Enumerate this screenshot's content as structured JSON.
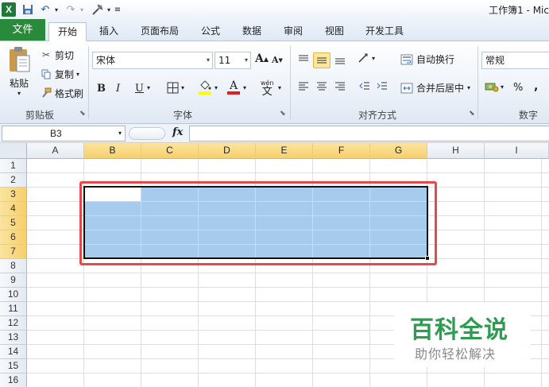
{
  "titlebar": {
    "title": "工作簿1  -  Mic",
    "undo_icon": "undo-icon",
    "redo_icon": "redo-icon",
    "save_icon": "save-icon"
  },
  "tabs": {
    "file": "文件",
    "items": [
      "开始",
      "插入",
      "页面布局",
      "公式",
      "数据",
      "审阅",
      "视图",
      "开发工具"
    ]
  },
  "ribbon": {
    "clipboard": {
      "paste": "粘贴",
      "cut": "剪切",
      "copy": "复制",
      "format_painter": "格式刷",
      "group_label": "剪贴板"
    },
    "font": {
      "font_name": "宋体",
      "font_size": "11",
      "bold": "B",
      "italic": "I",
      "underline": "U",
      "phonetic": "wén",
      "phonetic_char": "文",
      "group_label": "字体"
    },
    "alignment": {
      "wrap_text": "自动换行",
      "merge_center": "合并后居中",
      "group_label": "对齐方式"
    },
    "number": {
      "format": "常规",
      "percent": "%",
      "group_label": "数字"
    }
  },
  "formula_bar": {
    "name_box": "B3",
    "fx": "fx",
    "formula": ""
  },
  "sheet": {
    "columns": [
      "A",
      "B",
      "C",
      "D",
      "E",
      "F",
      "G",
      "H",
      "I"
    ],
    "rows": [
      "1",
      "2",
      "3",
      "4",
      "5",
      "6",
      "7",
      "8",
      "9",
      "10",
      "11",
      "12",
      "13",
      "14",
      "15",
      "16"
    ],
    "selected_columns": [
      "B",
      "C",
      "D",
      "E",
      "F",
      "G"
    ],
    "selected_rows": [
      "3",
      "4",
      "5",
      "6",
      "7"
    ],
    "selection_range": "B3:G7",
    "colors": {
      "selection_fill": "#a7cbec",
      "header_highlight": "#f7cf6b",
      "annotation_red": "#e34a4e"
    }
  },
  "watermark": {
    "title": "百科全说",
    "subtitle": "助你轻松解决"
  }
}
